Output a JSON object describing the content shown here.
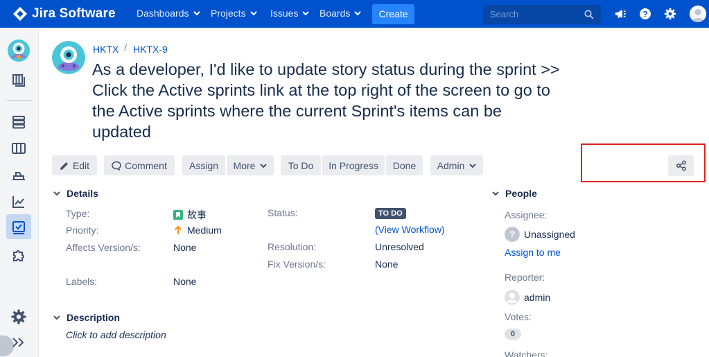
{
  "app": {
    "name": "Jira Software"
  },
  "nav": {
    "dashboards": "Dashboards",
    "projects": "Projects",
    "issues": "Issues",
    "boards": "Boards",
    "create": "Create",
    "search_placeholder": "Search"
  },
  "breadcrumb": {
    "project": "HKTX",
    "separator": "/",
    "issue_key": "HKTX-9"
  },
  "issue": {
    "summary": "As a developer, I'd like to update story status during the sprint >> Click the Active sprints link at the top right of the screen to go to the Active sprints where the current Sprint's items can be updated"
  },
  "toolbar": {
    "edit": "Edit",
    "comment": "Comment",
    "assign": "Assign",
    "more": "More",
    "todo": "To Do",
    "in_progress": "In Progress",
    "done": "Done",
    "admin": "Admin"
  },
  "details": {
    "heading": "Details",
    "type_label": "Type:",
    "type_value": "故事",
    "priority_label": "Priority:",
    "priority_value": "Medium",
    "affects_label": "Affects Version/s:",
    "affects_value": "None",
    "labels_label": "Labels:",
    "labels_value": "None",
    "status_label": "Status:",
    "status_value": "TO DO",
    "view_workflow": "(View Workflow)",
    "resolution_label": "Resolution:",
    "resolution_value": "Unresolved",
    "fix_label": "Fix Version/s:",
    "fix_value": "None"
  },
  "description": {
    "heading": "Description",
    "placeholder": "Click to add description"
  },
  "people": {
    "heading": "People",
    "assignee_label": "Assignee:",
    "assignee_value": "Unassigned",
    "assign_to_me": "Assign to me",
    "reporter_label": "Reporter:",
    "reporter_value": "admin",
    "votes_label": "Votes:",
    "votes_count": "0",
    "watchers_label": "Watchers:"
  },
  "colors": {
    "nav": "#0052cc",
    "create": "#2684ff",
    "link": "#0052cc",
    "priority_medium": "#ff8b00",
    "story": "#36b37e",
    "status_todo": "#42526e"
  }
}
